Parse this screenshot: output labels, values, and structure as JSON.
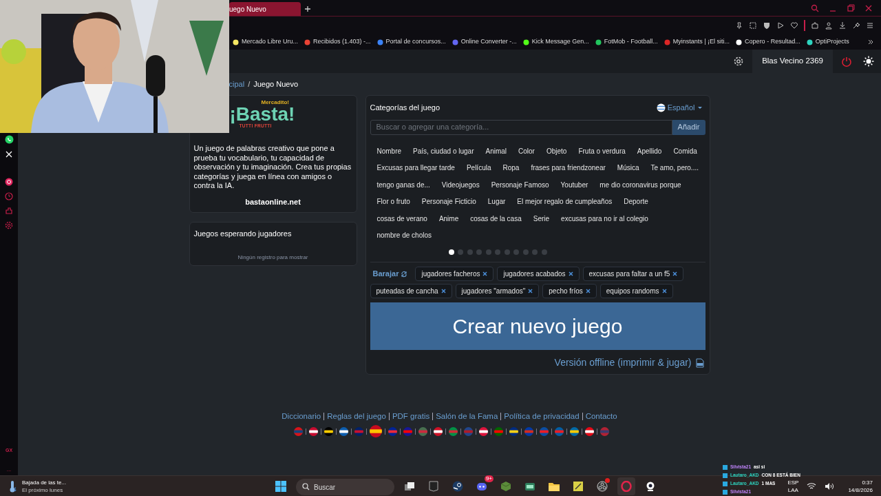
{
  "browser": {
    "tab_title": "uego Nuevo",
    "bookmarks": [
      {
        "label": "Mercado Libre Uru...",
        "color": "#f5e663"
      },
      {
        "label": "Recibidos (1.403) -...",
        "color": "#ea4335"
      },
      {
        "label": "Portal de concursos...",
        "color": "#3b82f6"
      },
      {
        "label": "Online Converter -...",
        "color": "#6366f1"
      },
      {
        "label": "Kick Message Gen...",
        "color": "#53fc18"
      },
      {
        "label": "FotMob - Football...",
        "color": "#22c55e"
      },
      {
        "label": "Myinstants | ¡El siti...",
        "color": "#dc2626"
      },
      {
        "label": "Copero - Resultad...",
        "color": "#ffffff"
      },
      {
        "label": "OptiProjects",
        "color": "#2dd4bf"
      }
    ],
    "sidebar_labels": [
      "GX",
      "..."
    ]
  },
  "site": {
    "user": "Blas Vecino 2369",
    "breadcrumb": [
      {
        "label": "cipal",
        "link": true
      },
      {
        "label": "Juego Nuevo",
        "link": false
      }
    ],
    "breadcrumb_separator": "/",
    "logo": {
      "top": "Mercadito!",
      "main": "¡Basta!",
      "bottom": "TUTTI FRUTTI"
    },
    "description": "Un juego de palabras creativo que pone a prueba tu vocabulario, tu capacidad de observación y tu imaginación. Crea tus propias categorías y juega en línea con amigos o contra la IA.",
    "site_link": "bastaonline.net",
    "waiting": {
      "title": "Juegos esperando jugadores",
      "empty": "Ningún registro para mostrar"
    },
    "categories": {
      "title": "Categorías del juego",
      "language": "Español",
      "search": {
        "placeholder": "Buscar o agregar una categoría..."
      },
      "add_button": "Añadir",
      "items": [
        "Nombre",
        "País, ciudad o lugar",
        "Animal",
        "Color",
        "Objeto",
        "Fruta o verdura",
        "Apellido",
        "Comida",
        "Excusas para llegar tarde",
        "Película",
        "Ropa",
        "frases para friendzonear",
        "Música",
        "Te amo, pero....",
        "tengo ganas de...",
        "Videojuegos",
        "Personaje Famoso",
        "Youtuber",
        "me dio coronavirus porque",
        "Flor o fruto",
        "Personaje Ficticio",
        "Lugar",
        "El mejor regalo de cumpleaños",
        "Deporte",
        "cosas de verano",
        "Anime",
        "cosas de la casa",
        "Serie",
        "excusas para no ir al colegio",
        "nombre de cholos"
      ],
      "pages": [
        {
          "selected": true
        },
        {
          "selected": false
        },
        {
          "selected": false
        },
        {
          "selected": false
        },
        {
          "selected": false
        },
        {
          "selected": false
        },
        {
          "selected": false
        },
        {
          "selected": false
        },
        {
          "selected": false
        },
        {
          "selected": false
        },
        {
          "selected": false
        }
      ],
      "shuffle": "Barajar",
      "chosen": [
        "jugadores facheros",
        "jugadores acabados",
        "excusas para faltar a un f5",
        "puteadas de cancha",
        "jugadores \"armados\"",
        "pecho fríos",
        "equipos randoms"
      ]
    },
    "create_button": "Crear nuevo juego",
    "offline_link": "Versión offline (imprimir & jugar)",
    "footer_links": [
      "Diccionario",
      "Reglas del juego",
      "PDF gratis",
      "Salón de la Fama",
      "Política de privacidad",
      "Contacto"
    ]
  },
  "taskbar": {
    "weather_title": "Bajada de las te...",
    "weather_subtitle": "El próximo lunes",
    "search": {
      "placeholder": "Buscar"
    },
    "apps": [
      {
        "kind": "windows",
        "active": false
      },
      {
        "kind": "taskview",
        "active": false
      },
      {
        "kind": "epic",
        "active": false
      },
      {
        "kind": "steam",
        "active": false
      },
      {
        "kind": "discord",
        "active": false,
        "badge": "9+"
      },
      {
        "kind": "cube",
        "active": false
      },
      {
        "kind": "android",
        "active": false
      },
      {
        "kind": "folder",
        "active": false
      },
      {
        "kind": "note",
        "active": false
      },
      {
        "kind": "obs",
        "active": false,
        "notification": true
      },
      {
        "kind": "opera",
        "active": true
      },
      {
        "kind": "webcam",
        "active": false
      }
    ],
    "language": "ESP",
    "layout": "LAA",
    "time": "0:37",
    "date": "14/8/2026"
  },
  "chat_overlay": [
    {
      "user": "Silvista21",
      "message": "asi si",
      "color": "#c084fc"
    },
    {
      "user": "Lautaro_AKD",
      "message": "CON 8 ESTÁ BIEN",
      "color": "#2dd4bf"
    },
    {
      "user": "Lautaro_AKD",
      "message": "1 MAS",
      "color": "#2dd4bf"
    },
    {
      "user": "Silvista21",
      "color": "#c084fc"
    }
  ]
}
